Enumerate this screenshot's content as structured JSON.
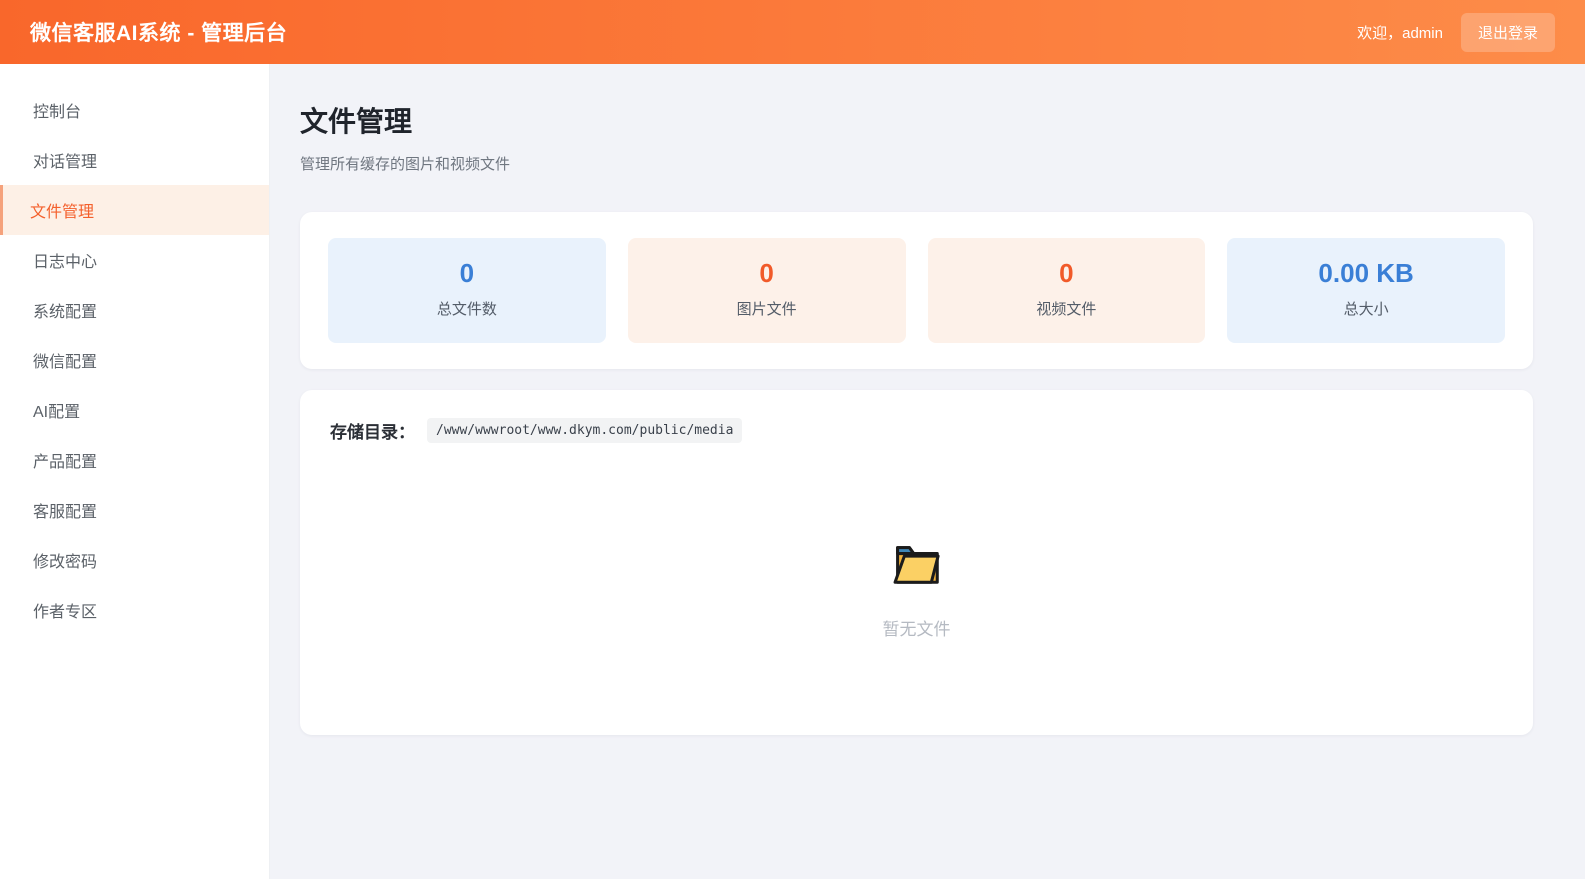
{
  "header": {
    "title": "微信客服AI系统 - 管理后台",
    "welcome": "欢迎，admin",
    "logout_label": "退出登录"
  },
  "sidebar": {
    "items": [
      {
        "label": "控制台",
        "active": false
      },
      {
        "label": "对话管理",
        "active": false
      },
      {
        "label": "文件管理",
        "active": true
      },
      {
        "label": "日志中心",
        "active": false
      },
      {
        "label": "系统配置",
        "active": false
      },
      {
        "label": "微信配置",
        "active": false
      },
      {
        "label": "AI配置",
        "active": false
      },
      {
        "label": "产品配置",
        "active": false
      },
      {
        "label": "客服配置",
        "active": false
      },
      {
        "label": "修改密码",
        "active": false
      },
      {
        "label": "作者专区",
        "active": false
      }
    ]
  },
  "main": {
    "page_title": "文件管理",
    "page_subtitle": "管理所有缓存的图片和视频文件",
    "stats": [
      {
        "value": "0",
        "label": "总文件数",
        "color": "blue"
      },
      {
        "value": "0",
        "label": "图片文件",
        "color": "orange"
      },
      {
        "value": "0",
        "label": "视频文件",
        "color": "orange"
      },
      {
        "value": "0.00 KB",
        "label": "总大小",
        "color": "blue"
      }
    ],
    "storage": {
      "label": "存储目录：",
      "path": "/www/wwwroot/www.dkym.com/public/media"
    },
    "empty": {
      "icon": "open-folder-icon",
      "text": "暂无文件"
    }
  },
  "colors": {
    "header_gradient_start": "#f9672b",
    "header_gradient_end": "#fd8c49",
    "accent_orange": "#f15a29",
    "accent_blue": "#3a7fd6",
    "active_item_bg": "#fdf0e6",
    "stat_bg_blue": "#e9f2fc",
    "stat_bg_orange": "#fdf1e9",
    "page_bg": "#f2f3f8"
  }
}
